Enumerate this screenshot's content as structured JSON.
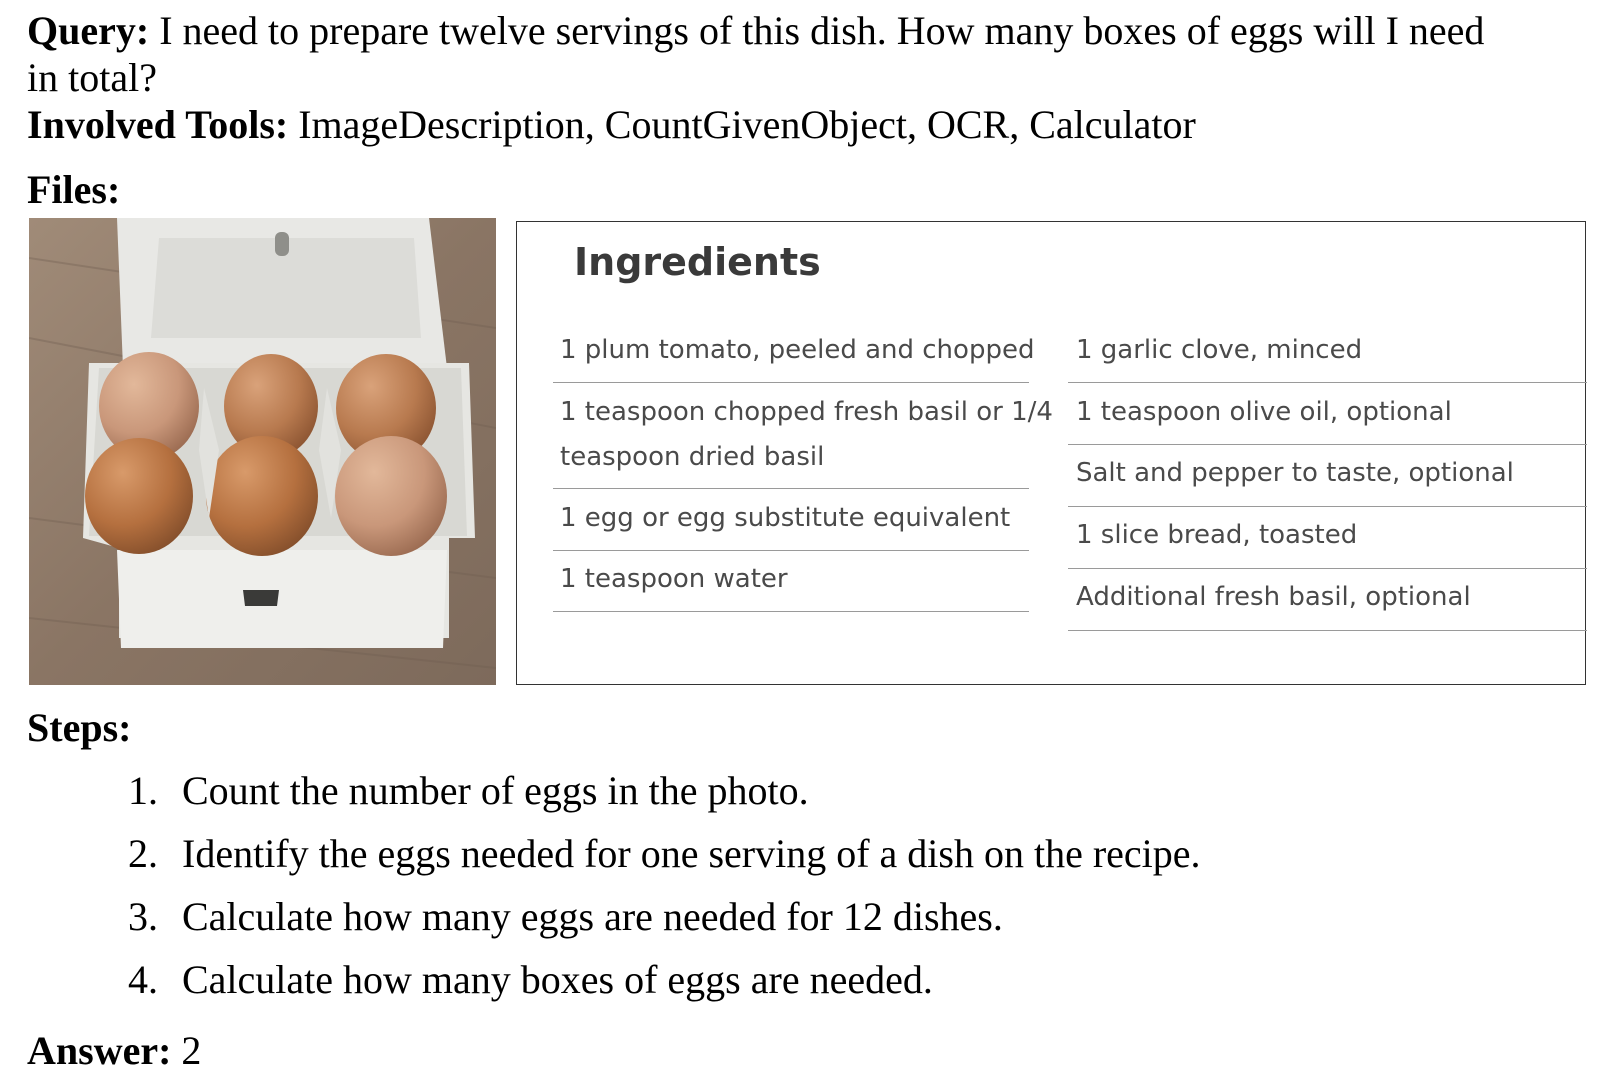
{
  "query": {
    "label": "Query:",
    "text_line1": " I need to prepare twelve servings of this dish. How many boxes of eggs will I need",
    "text_line2": "in total?"
  },
  "tools": {
    "label": "Involved Tools:",
    "text": " ImageDescription, CountGivenObject, OCR, Calculator"
  },
  "files": {
    "label": "Files:"
  },
  "ingredients": {
    "title": "Ingredients",
    "left_column": [
      "1 plum tomato, peeled and chopped",
      "1 teaspoon chopped fresh basil or 1/4",
      "teaspoon dried basil",
      "1 egg or egg substitute equivalent",
      "1 teaspoon water"
    ],
    "right_column": [
      "1 garlic clove, minced",
      "1 teaspoon olive oil, optional",
      "Salt and pepper to taste, optional",
      "1 slice bread, toasted",
      "Additional fresh basil, optional"
    ]
  },
  "steps": {
    "label": "Steps:",
    "items": [
      {
        "num": "1.",
        "text": "Count the number of eggs in the photo."
      },
      {
        "num": "2.",
        "text": "Identify the eggs needed for one serving of a dish on the recipe."
      },
      {
        "num": "3.",
        "text": "Calculate how many eggs are needed for 12 dishes."
      },
      {
        "num": "4.",
        "text": "Calculate how many boxes of eggs are needed."
      }
    ]
  },
  "answer": {
    "label": "Answer:",
    "value": " 2"
  },
  "photo": {
    "egg_count": 6,
    "colors": {
      "carton": "#e9e9e6",
      "table": "#8c7a6a",
      "egg": "#b87a4f"
    }
  }
}
